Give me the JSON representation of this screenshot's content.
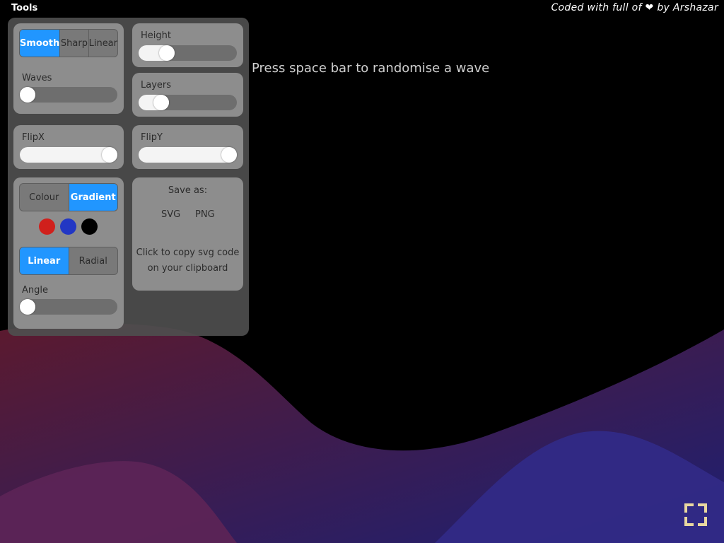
{
  "header": {
    "tools_label": "Tools",
    "credit_prefix": "Coded with full of",
    "credit_heart": "❤",
    "credit_suffix": "by Arshazar"
  },
  "hint": "Press space bar to randomise a wave",
  "curve": {
    "options": [
      "Smooth",
      "Sharp",
      "Linear"
    ],
    "selected": "Smooth"
  },
  "waves": {
    "label": "Waves",
    "value_fraction": 0.0
  },
  "height": {
    "label": "Height",
    "value_fraction": 0.25
  },
  "layers": {
    "label": "Layers",
    "value_fraction": 0.18
  },
  "flipx": {
    "label": "FlipX",
    "value": true
  },
  "flipy": {
    "label": "FlipY",
    "value": true
  },
  "fill_mode": {
    "options": [
      "Colour",
      "Gradient"
    ],
    "selected": "Gradient"
  },
  "colors": {
    "swatches": [
      {
        "name": "red",
        "hex": "#d0201c"
      },
      {
        "name": "blue",
        "hex": "#2237c4"
      },
      {
        "name": "black",
        "hex": "#000000"
      }
    ]
  },
  "gradient_type": {
    "options": [
      "Linear",
      "Radial"
    ],
    "selected": "Linear"
  },
  "angle": {
    "label": "Angle",
    "value_fraction": 0.0
  },
  "save": {
    "title": "Save as:",
    "svg_label": "SVG",
    "png_label": "PNG",
    "copy_text_line1": "Click to copy svg code",
    "copy_text_line2": "on your clipboard"
  },
  "theme": {
    "accent": "#2196ff",
    "panel_bg": "#4e4e4e",
    "card_bg": "#8d8d8d",
    "fullscreen_icon_color": "#e8d7a0"
  },
  "icons": {
    "fullscreen": "fullscreen-icon"
  }
}
